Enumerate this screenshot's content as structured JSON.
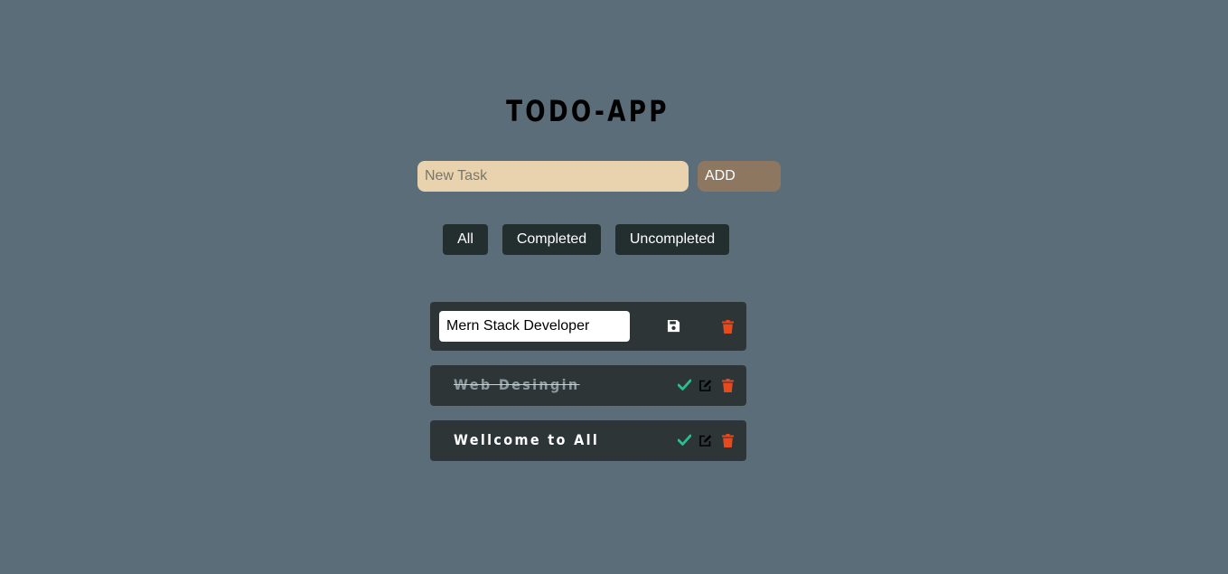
{
  "header": {
    "title": "TODO-APP"
  },
  "new_task": {
    "placeholder": "New Task",
    "value": "",
    "add_label": "ADD"
  },
  "filters": [
    {
      "label": "All"
    },
    {
      "label": "Completed"
    },
    {
      "label": "Uncompleted"
    }
  ],
  "todos": [
    {
      "text": "Mern Stack Developer",
      "completed": false,
      "editing": true,
      "icons": [
        "save-icon",
        "trash-icon"
      ]
    },
    {
      "text": "Web Desingin",
      "completed": true,
      "editing": false,
      "icons": [
        "check-icon",
        "edit-icon",
        "trash-icon"
      ]
    },
    {
      "text": "Wellcome to All",
      "completed": false,
      "editing": false,
      "icons": [
        "check-icon",
        "edit-icon",
        "trash-icon"
      ]
    }
  ],
  "colors": {
    "background": "#5a6d79",
    "input_bg": "#e8d3ae",
    "add_button_bg": "#8e7760",
    "filter_button_bg": "#232e2f",
    "row_bg": "#2e3536",
    "check": "#2bbf8d",
    "trash": "#e8491d"
  }
}
